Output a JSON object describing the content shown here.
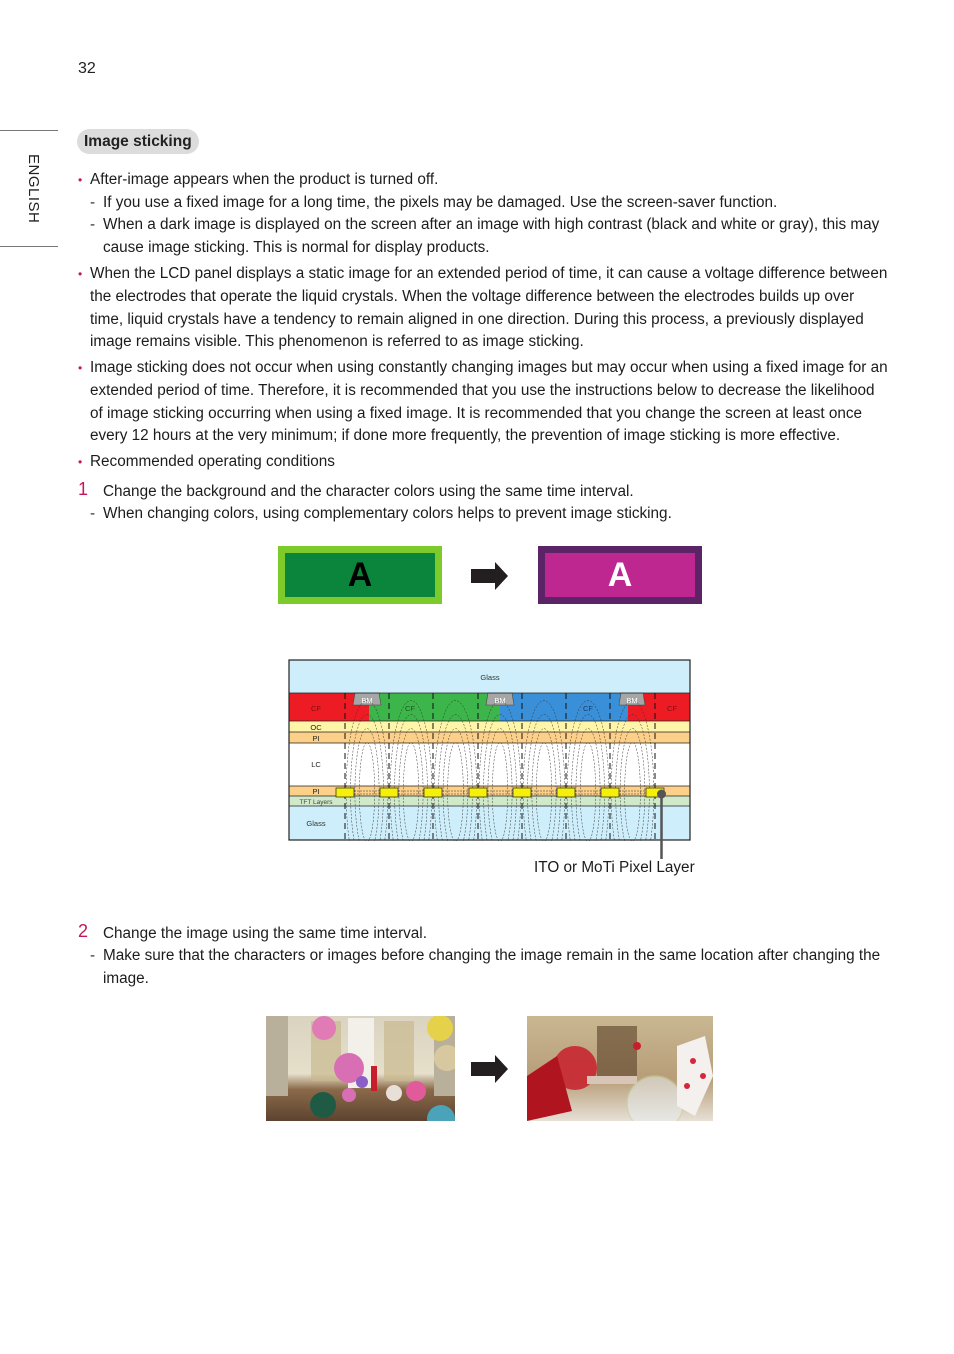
{
  "page": {
    "number": "32",
    "language_tab": "ENGLISH",
    "section_title": "Image sticking"
  },
  "content": {
    "b1": "After-image appears when the product is turned off.",
    "b1_sub1": "If you use a fixed image for a long time, the pixels may be damaged. Use the screen-saver function.",
    "b1_sub2_l1": "When a dark image is displayed on the screen after an image with high contrast (black and white or gray), this may",
    "b1_sub2_l2": "cause image sticking. This is normal for display products.",
    "b2_l1": "When the LCD panel displays a static image for an extended period of time, it can cause a voltage difference between",
    "b2_l2": "the electrodes that operate the liquid crystals. When the voltage difference between the electrodes builds up over",
    "b2_l3": "time, liquid crystals have a tendency to remain aligned in one direction. During this process, a previously displayed",
    "b2_l4": "image remains visible. This phenomenon is referred to as image sticking.",
    "b3_l1": "Image sticking does not occur when using constantly changing images but may occur when using a fixed image for an",
    "b3_l2": "extended period of time. Therefore, it is recommended that you use the instructions below to decrease the likelihood",
    "b3_l3": "of image sticking occurring when using a fixed image. It is recommended that you change the screen at least once",
    "b3_l4": "every 12 hours at the very minimum; if done more frequently, the prevention of image sticking is more effective.",
    "b4": "Recommended operating conditions",
    "step1_num": "1",
    "step1": "Change the background and the character colors using the same time interval.",
    "step1_sub": "When changing colors, using complementary colors helps to prevent image sticking.",
    "step2_num": "2",
    "step2": "Change the image using the same time interval.",
    "step2_sub_l1": "Make sure that the characters or images before changing the image remain in the same location after changing the",
    "step2_sub_l2": "image.",
    "bullet_glyph": "•",
    "dash_glyph": "-"
  },
  "color_example": {
    "before": {
      "letter": "A",
      "fill": "#0b853c",
      "border": "#7dcb2a",
      "letter_color": "#000000"
    },
    "after": {
      "letter": "A",
      "fill": "#be2690",
      "border": "#5a2466",
      "letter_color": "#ffffff"
    },
    "arrow_color": "#231f20"
  },
  "diagram": {
    "layers": {
      "glass_top": "Glass",
      "cf": "CF",
      "bm": "BM",
      "oc": "OC",
      "pi_top": "PI",
      "lc": "LC",
      "pi_bottom": "PI",
      "tft": "TFT Layers",
      "glass_bottom": "Glass"
    },
    "callout": "ITO or MoTi Pixel Layer",
    "colors": {
      "glass": "#cdeefa",
      "red": "#ed1c24",
      "green": "#3cb54a",
      "blue": "#3a8fd9",
      "bm": "#a6a6a6",
      "oc": "#fff5a8",
      "pi": "#fcd089",
      "tft": "#cfe9c9",
      "electrode": "#f5ef0a"
    }
  },
  "image_example": {
    "before_alt": "Ballroom scene with colorful balloons",
    "after_alt": "Ballroom scene with circus performers and bubble"
  }
}
